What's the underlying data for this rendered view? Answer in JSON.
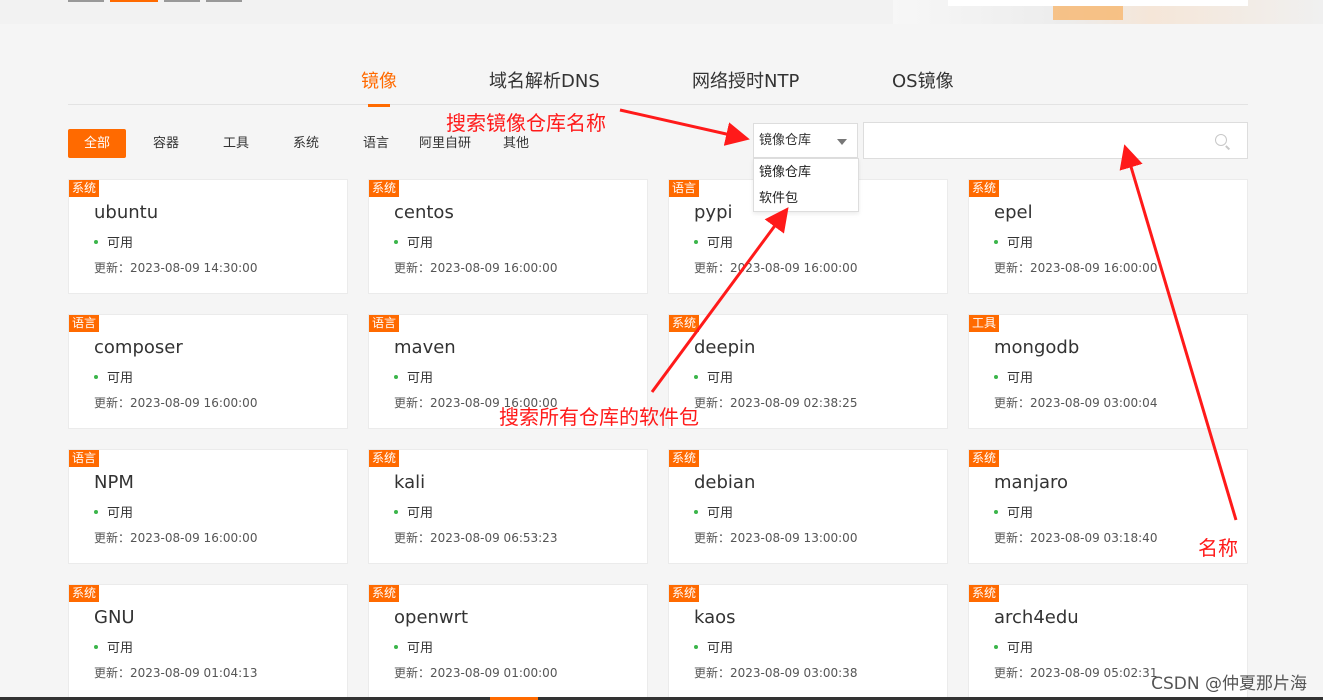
{
  "tabs": [
    {
      "label": "镜像",
      "active": true
    },
    {
      "label": "域名解析DNS",
      "active": false
    },
    {
      "label": "网络授时NTP",
      "active": false
    },
    {
      "label": "OS镜像",
      "active": false
    }
  ],
  "filters": [
    {
      "label": "全部",
      "active": true
    },
    {
      "label": "容器"
    },
    {
      "label": "工具"
    },
    {
      "label": "系统"
    },
    {
      "label": "语言"
    },
    {
      "label": "阿里自研"
    },
    {
      "label": "其他"
    }
  ],
  "search": {
    "scope_selected": "镜像仓库",
    "scope_options": [
      "镜像仓库",
      "软件包"
    ],
    "input_value": "",
    "icon": "search-icon"
  },
  "cards": [
    {
      "tag": "系统",
      "name": "ubuntu",
      "status": "可用",
      "updated": "更新：2023-08-09 14:30:00"
    },
    {
      "tag": "系统",
      "name": "centos",
      "status": "可用",
      "updated": "更新：2023-08-09 16:00:00"
    },
    {
      "tag": "语言",
      "name": "pypi",
      "status": "可用",
      "updated": "更新：2023-08-09 16:00:00"
    },
    {
      "tag": "系统",
      "name": "epel",
      "status": "可用",
      "updated": "更新：2023-08-09 16:00:00"
    },
    {
      "tag": "语言",
      "name": "composer",
      "status": "可用",
      "updated": "更新：2023-08-09 16:00:00"
    },
    {
      "tag": "语言",
      "name": "maven",
      "status": "可用",
      "updated": "更新：2023-08-09 16:00:00"
    },
    {
      "tag": "系统",
      "name": "deepin",
      "status": "可用",
      "updated": "更新：2023-08-09 02:38:25"
    },
    {
      "tag": "工具",
      "name": "mongodb",
      "status": "可用",
      "updated": "更新：2023-08-09 03:00:04"
    },
    {
      "tag": "语言",
      "name": "NPM",
      "status": "可用",
      "updated": "更新：2023-08-09 16:00:00"
    },
    {
      "tag": "系统",
      "name": "kali",
      "status": "可用",
      "updated": "更新：2023-08-09 06:53:23"
    },
    {
      "tag": "系统",
      "name": "debian",
      "status": "可用",
      "updated": "更新：2023-08-09 13:00:00"
    },
    {
      "tag": "系统",
      "name": "manjaro",
      "status": "可用",
      "updated": "更新：2023-08-09 03:18:40"
    },
    {
      "tag": "系统",
      "name": "GNU",
      "status": "可用",
      "updated": "更新：2023-08-09 01:04:13"
    },
    {
      "tag": "系统",
      "name": "openwrt",
      "status": "可用",
      "updated": "更新：2023-08-09 01:00:00"
    },
    {
      "tag": "系统",
      "name": "kaos",
      "status": "可用",
      "updated": "更新：2023-08-09 03:00:38"
    },
    {
      "tag": "系统",
      "name": "arch4edu",
      "status": "可用",
      "updated": "更新：2023-08-09 05:02:31"
    }
  ],
  "annotations": {
    "search_repo_name": "搜索镜像仓库名称",
    "search_all_packages": "搜索所有仓库的软件包",
    "name": "名称"
  },
  "watermark": "CSDN @仲夏那片海",
  "colors": {
    "accent": "#ff6a00",
    "status_available": "#3bb54a",
    "annotation": "#ff1a1a"
  }
}
